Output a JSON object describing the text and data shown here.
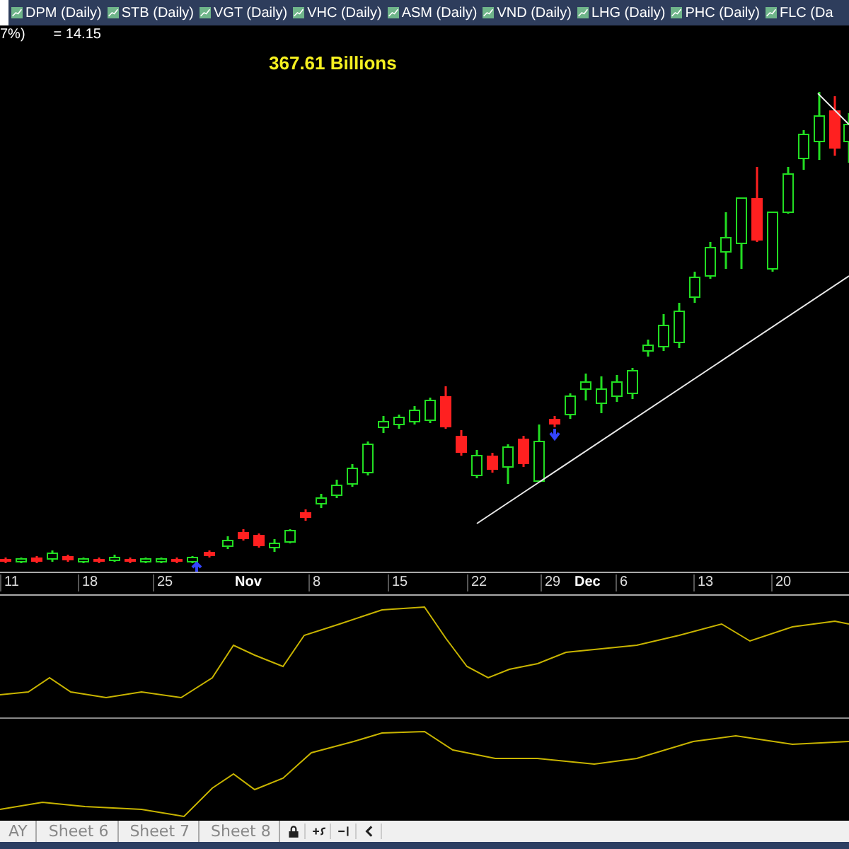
{
  "tabs": [
    {
      "label": "DPM (Daily)",
      "selected": false
    },
    {
      "label": "STB (Daily)",
      "selected": false
    },
    {
      "label": "VGT (Daily)",
      "selected": false
    },
    {
      "label": "VHC (Daily)",
      "selected": false
    },
    {
      "label": "ASM (Daily)",
      "selected": false
    },
    {
      "label": "VND (Daily)",
      "selected": false
    },
    {
      "label": "LHG (Daily)",
      "selected": false
    },
    {
      "label": "PHC (Daily)",
      "selected": false
    },
    {
      "label": "FLC (Da",
      "selected": false
    }
  ],
  "header": {
    "change": "7%)",
    "value": "= 14.15",
    "volume": "367.61 Billions"
  },
  "axis_labels": [
    {
      "label": "11",
      "kind": "day"
    },
    {
      "label": "18",
      "kind": "day"
    },
    {
      "label": "25",
      "kind": "day"
    },
    {
      "label": "Nov",
      "kind": "month"
    },
    {
      "label": "8",
      "kind": "day"
    },
    {
      "label": "15",
      "kind": "day"
    },
    {
      "label": "22",
      "kind": "day"
    },
    {
      "label": "29",
      "kind": "day"
    },
    {
      "label": "Dec",
      "kind": "month"
    },
    {
      "label": "6",
      "kind": "day"
    },
    {
      "label": "13",
      "kind": "day"
    },
    {
      "label": "20",
      "kind": "day"
    }
  ],
  "sheet_tabs": [
    {
      "label": "AY",
      "selected": false
    },
    {
      "label": "Sheet 6",
      "selected": false
    },
    {
      "label": "Sheet 7",
      "selected": false
    },
    {
      "label": "Sheet 8",
      "selected": false
    }
  ]
}
